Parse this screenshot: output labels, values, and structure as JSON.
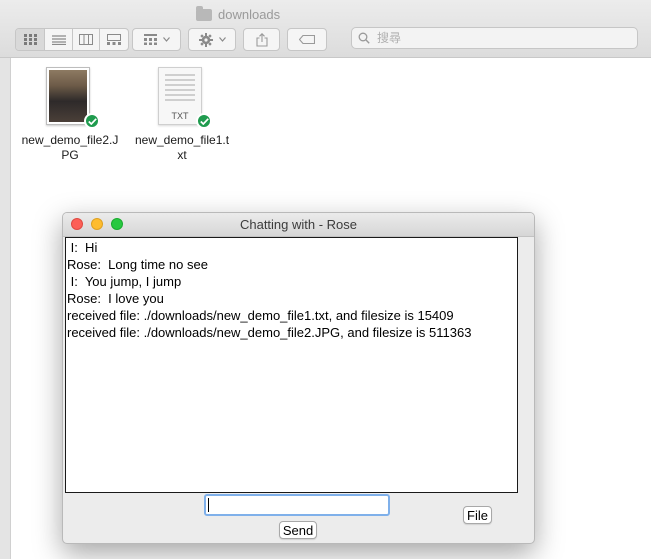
{
  "finder": {
    "title": "downloads",
    "search_placeholder": "搜尋",
    "files": [
      {
        "name": "new_demo_file2.JPG",
        "kind": "photo",
        "synced": true
      },
      {
        "name": "new_demo_file1.txt",
        "kind": "text",
        "icon_label": "TXT",
        "synced": true
      }
    ]
  },
  "chat": {
    "title": "Chatting with - Rose",
    "messages": [
      " I:  Hi",
      "Rose:  Long time no see",
      " I:  You jump, I jump",
      "Rose:  I love you",
      "received file: ./downloads/new_demo_file1.txt, and filesize is 15409",
      "received file: ./downloads/new_demo_file2.JPG, and filesize is 511363"
    ],
    "input_value": "",
    "send_label": "Send",
    "file_label": "File"
  },
  "colors": {
    "close": "#fd5f57",
    "minimize": "#febc2e",
    "maximize": "#28c840",
    "sync_badge": "#1f9b4e",
    "input_focus": "#7fb0ea"
  }
}
